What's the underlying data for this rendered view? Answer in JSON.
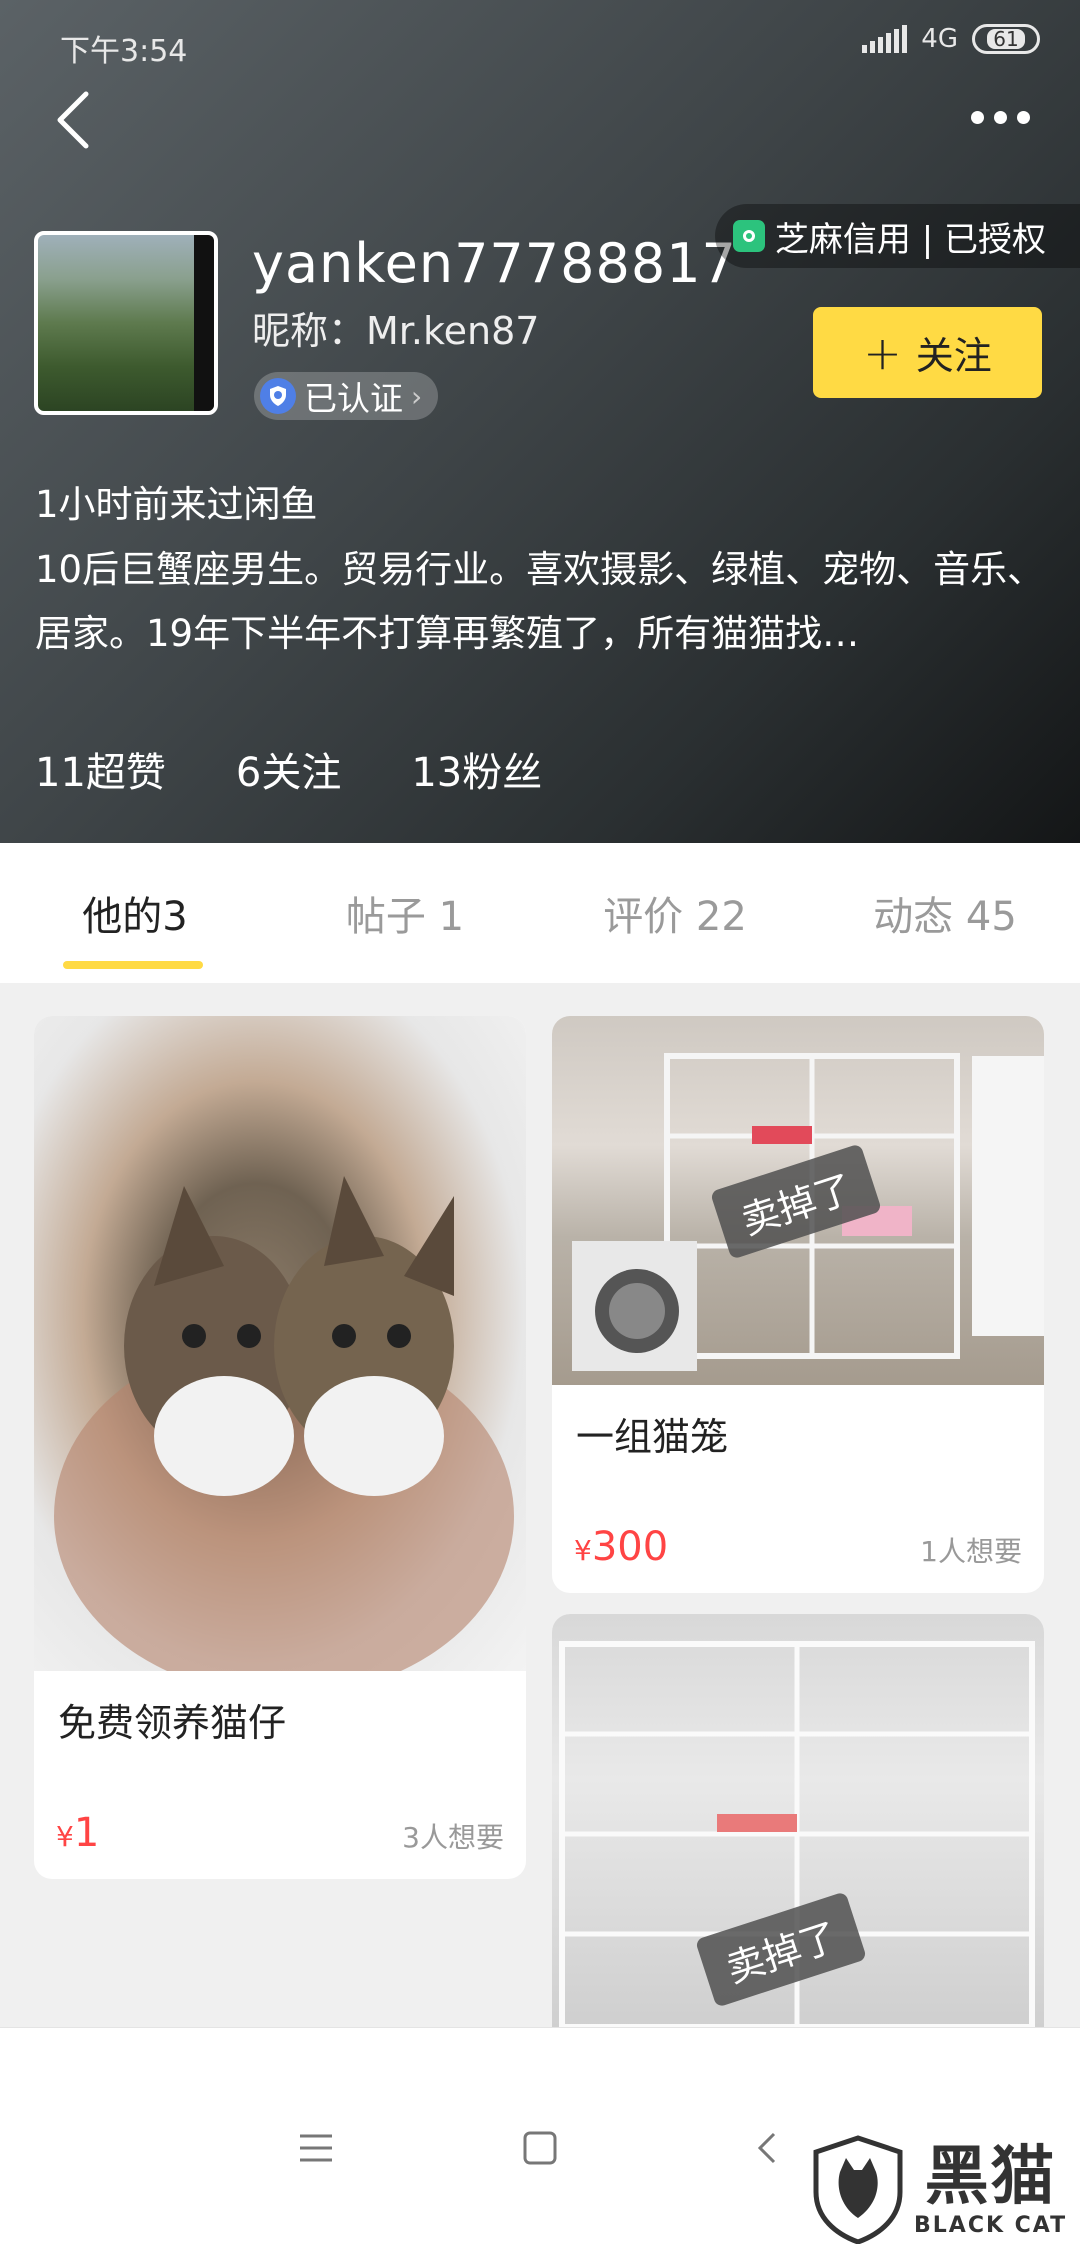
{
  "status_bar": {
    "time": "下午3:54",
    "network": "4G",
    "battery": "61"
  },
  "profile": {
    "username": "yanken77788817",
    "nickname": "昵称：Mr.ken87",
    "verified_label": "已认证",
    "credit_label": "芝麻信用 | 已授权",
    "follow_label": "关注",
    "last_seen": "1小时前来过闲鱼",
    "bio": "10后巨蟹座男生。贸易行业。喜欢摄影、绿植、宠物、音乐、居家。19年下半年不打算再繁殖了，所有猫猫找…",
    "stats": {
      "likes": "11超赞",
      "following": "6关注",
      "followers": "13粉丝"
    }
  },
  "tabs": [
    {
      "label": "他的3"
    },
    {
      "label": "帖子 1"
    },
    {
      "label": "评价 22"
    },
    {
      "label": "动态 45"
    }
  ],
  "items": [
    {
      "title": "免费领养猫仔",
      "currency": "¥",
      "price": "1",
      "wants": "3人想要",
      "sold": false
    },
    {
      "title": "一组猫笼",
      "currency": "¥",
      "price": "300",
      "wants": "1人想要",
      "sold": true,
      "sold_label": "卖掉了"
    },
    {
      "sold": true,
      "sold_label": "卖掉了"
    }
  ],
  "watermark": {
    "cn": "黑猫",
    "en": "BLACK CAT"
  },
  "colors": {
    "accent": "#ffda44",
    "price": "#ff4444",
    "credit": "#2cc37d"
  }
}
